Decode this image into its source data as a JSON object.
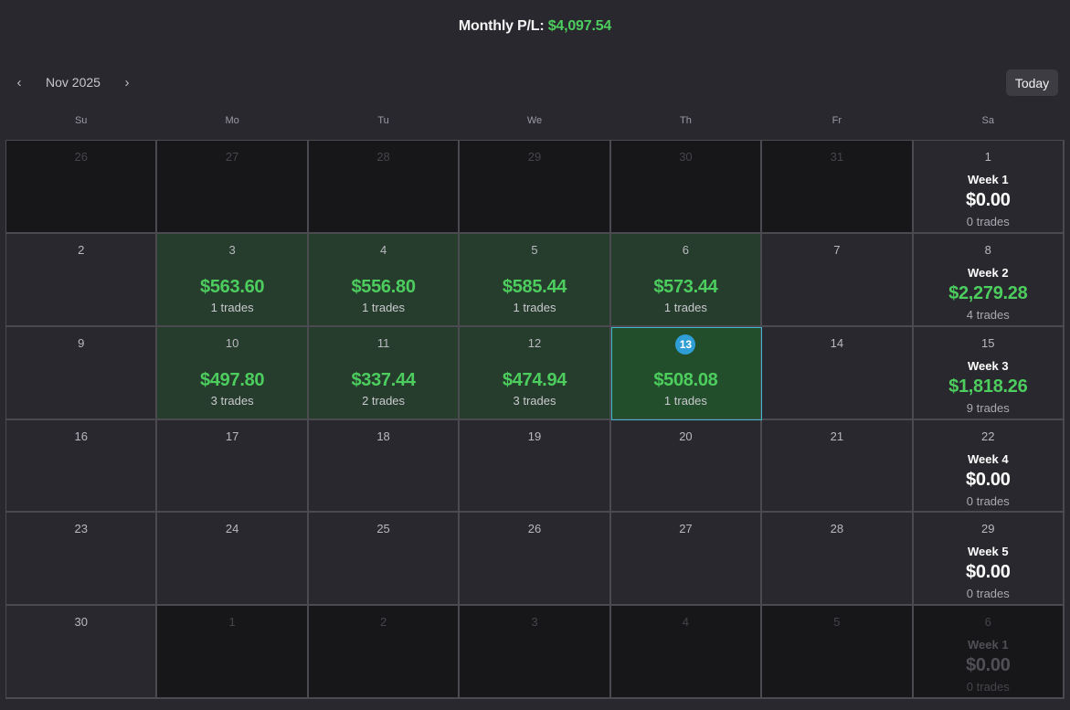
{
  "header": {
    "title_label": "Monthly P/L:",
    "title_value": "$4,097.54"
  },
  "toolbar": {
    "prev_icon": "‹",
    "next_icon": "›",
    "month": "Nov 2025",
    "today_label": "Today"
  },
  "weekdays": [
    "Su",
    "Mo",
    "Tu",
    "We",
    "Th",
    "Fr",
    "Sa"
  ],
  "colors": {
    "profit": "#4ccd5e",
    "today_badge": "#2f9ed6",
    "today_border": "#3fb8c9"
  },
  "weeks": [
    {
      "days": [
        {
          "day": "26",
          "outside": true
        },
        {
          "day": "27",
          "outside": true
        },
        {
          "day": "28",
          "outside": true
        },
        {
          "day": "29",
          "outside": true
        },
        {
          "day": "30",
          "outside": true
        },
        {
          "day": "31",
          "outside": true
        },
        {
          "day": "1"
        }
      ],
      "summary": {
        "label": "Week 1",
        "pnl": "$0.00",
        "trades": "0 trades"
      }
    },
    {
      "days": [
        {
          "day": "2"
        },
        {
          "day": "3",
          "pnl": "$563.60",
          "trades": "1 trades"
        },
        {
          "day": "4",
          "pnl": "$556.80",
          "trades": "1 trades"
        },
        {
          "day": "5",
          "pnl": "$585.44",
          "trades": "1 trades"
        },
        {
          "day": "6",
          "pnl": "$573.44",
          "trades": "1 trades"
        },
        {
          "day": "7"
        },
        {
          "day": "8"
        }
      ],
      "summary": {
        "label": "Week 2",
        "pnl": "$2,279.28",
        "trades": "4 trades",
        "positive": true
      }
    },
    {
      "days": [
        {
          "day": "9"
        },
        {
          "day": "10",
          "pnl": "$497.80",
          "trades": "3 trades"
        },
        {
          "day": "11",
          "pnl": "$337.44",
          "trades": "2 trades"
        },
        {
          "day": "12",
          "pnl": "$474.94",
          "trades": "3 trades"
        },
        {
          "day": "13",
          "pnl": "$508.08",
          "trades": "1 trades",
          "today": true
        },
        {
          "day": "14"
        },
        {
          "day": "15"
        }
      ],
      "summary": {
        "label": "Week 3",
        "pnl": "$1,818.26",
        "trades": "9 trades",
        "positive": true
      }
    },
    {
      "days": [
        {
          "day": "16"
        },
        {
          "day": "17"
        },
        {
          "day": "18"
        },
        {
          "day": "19"
        },
        {
          "day": "20"
        },
        {
          "day": "21"
        },
        {
          "day": "22"
        }
      ],
      "summary": {
        "label": "Week 4",
        "pnl": "$0.00",
        "trades": "0 trades"
      }
    },
    {
      "days": [
        {
          "day": "23"
        },
        {
          "day": "24"
        },
        {
          "day": "25"
        },
        {
          "day": "26"
        },
        {
          "day": "27"
        },
        {
          "day": "28"
        },
        {
          "day": "29"
        }
      ],
      "summary": {
        "label": "Week 5",
        "pnl": "$0.00",
        "trades": "0 trades"
      }
    },
    {
      "days": [
        {
          "day": "30"
        },
        {
          "day": "1",
          "outside": true
        },
        {
          "day": "2",
          "outside": true
        },
        {
          "day": "3",
          "outside": true
        },
        {
          "day": "4",
          "outside": true
        },
        {
          "day": "5",
          "outside": true
        },
        {
          "day": "6",
          "outside": true
        }
      ],
      "summary": {
        "label": "Week 1",
        "pnl": "$0.00",
        "trades": "0 trades"
      }
    }
  ]
}
